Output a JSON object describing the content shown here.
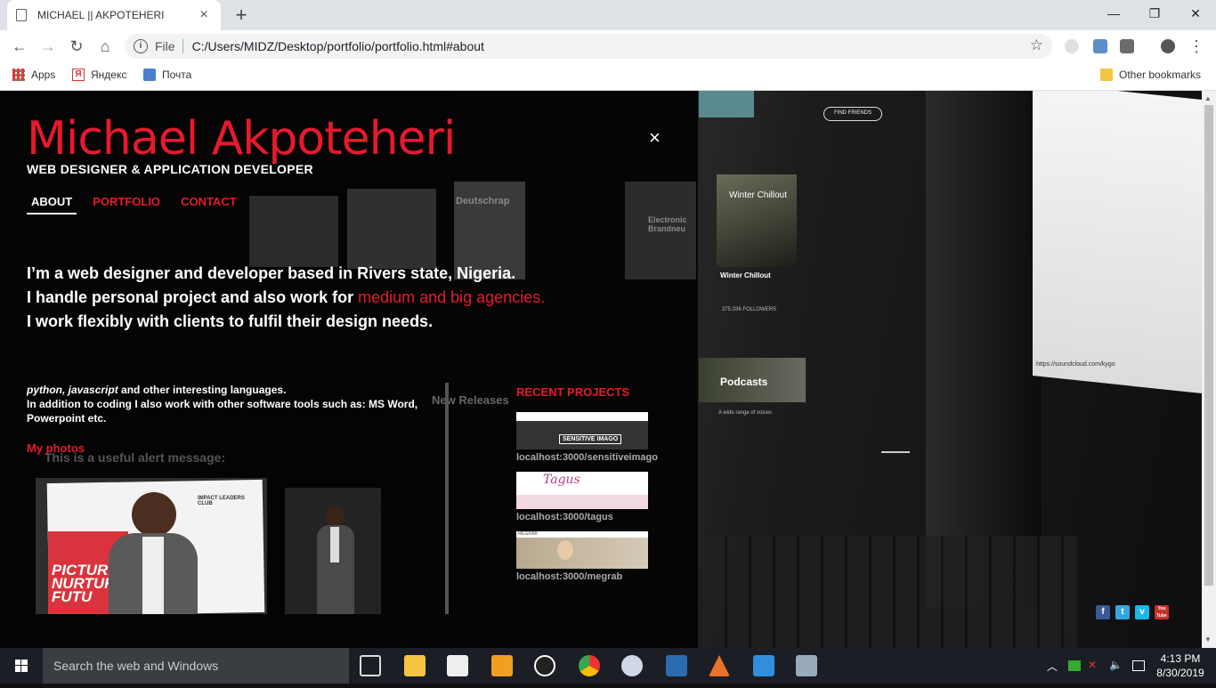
{
  "browser": {
    "tab_title": "MICHAEL || AKPOTEHERI",
    "tab_close": "×",
    "new_tab": "+",
    "window_controls": {
      "minimize": "—",
      "maximize": "❐",
      "close": "✕"
    },
    "nav": {
      "back": "←",
      "forward": "→",
      "reload": "↻",
      "home": "⌂"
    },
    "address": {
      "info": "i",
      "scheme_label": "File",
      "url": "C:/Users/MIDZ/Desktop/portfolio/portfolio.html#about",
      "star": "☆"
    },
    "bookmarks": [
      {
        "label": "Apps",
        "icon": "apps-grid-icon"
      },
      {
        "label": "Яндекс",
        "icon": "yandex-icon"
      },
      {
        "label": "Почта",
        "icon": "mail-icon"
      }
    ],
    "other_bookmarks": "Other bookmarks",
    "colors": {
      "accent_red": "#e8192c",
      "chrome_gray": "#dee1e6"
    }
  },
  "page": {
    "close": "×",
    "name": "Michael Akpoteheri",
    "role": "WEB DESIGNER & APPLICATION DEVELOPER",
    "menu": [
      {
        "label": "ABOUT",
        "active": true
      },
      {
        "label": "PORTFOLIO",
        "active": false
      },
      {
        "label": "CONTACT",
        "active": false
      }
    ],
    "intro": {
      "line1": "I’m a web designer and developer based in Rivers state, Nigeria.",
      "line2_start": "I handle personal project and also work for ",
      "line2_accent": "medium and big agencies.",
      "line3": "I work flexibly with clients to fulfil their design needs."
    },
    "languages": {
      "italic": "python, javascript",
      "rest": " and other interesting languages.",
      "line2": "In addition to coding I also work with other software tools such as: MS Word, Powerpoint etc."
    },
    "photos_title": "My photos",
    "recent_title": "RECENT PROJECTS",
    "projects": [
      {
        "url": "localhost:3000/sensitiveimago",
        "thumb_text": "SENSITIVE IMAGO"
      },
      {
        "url": "localhost:3000/tagus",
        "thumb_text": "Tagus"
      },
      {
        "url": "localhost:3000/megrab",
        "thumb_text": "MEGRAB"
      }
    ],
    "photo1_banner": {
      "line1": "PICTURI",
      "line2": "NURTUR",
      "line3": "FUTU",
      "club": "IMPACT LEADERS CLUB"
    },
    "background_texts": {
      "find_friends": "FIND FRIENDS",
      "winter_chillout": "Winter Chillout",
      "winter_chillout_caption": "Winter Chillout",
      "followers": "375.036 FOLLOWERS",
      "podcasts": "Podcasts",
      "podcasts_caption": "A wide range of voices",
      "soundcloud_url": "https://soundcloud.com/kygo",
      "new_releases": "New Releases",
      "alert": "This is a useful alert message:",
      "deutschrap": "Deutschrap",
      "electronic": "Electronic Brandneu"
    },
    "social": [
      "f",
      "t",
      "v",
      "You Tube"
    ]
  },
  "taskbar": {
    "search_placeholder": "Search the web and Windows",
    "time": "4:13 PM",
    "date": "8/30/2019"
  }
}
